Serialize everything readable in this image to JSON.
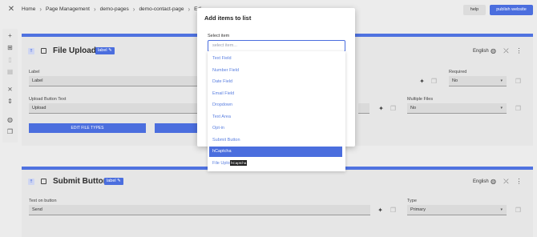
{
  "topbar": {
    "breadcrumbs": [
      "Home",
      "Page Management",
      "demo-pages",
      "demo-contact-page",
      "Edi"
    ],
    "help_label": "help",
    "publish_label": "publish website"
  },
  "card1": {
    "title": "File Upload",
    "badge": "label",
    "lang": "English",
    "label_caption": "Label",
    "label_value": "Label",
    "required_caption": "Required",
    "required_value": "No",
    "upload_caption": "Upload Button Text",
    "upload_value": "Upload",
    "multiple_caption": "Multiple Files",
    "multiple_value": "No",
    "edit_types_label": "EDIT FILE TYPES"
  },
  "card2": {
    "title": "Submit Button",
    "badge": "label",
    "lang": "English",
    "text_caption": "Text on button",
    "text_value": "Send",
    "type_caption": "Type",
    "type_value": "Primary"
  },
  "modal": {
    "title": "Add items to list",
    "select_label": "Select item",
    "placeholder": "select item..."
  },
  "dropdown": {
    "items": [
      "Text Field",
      "Number Field",
      "Date Field",
      "Email Field",
      "Dropdown",
      "Text Area",
      "Opt-in",
      "Submit Button",
      "hCaptcha",
      "File Upload"
    ],
    "selected": "hCaptcha",
    "tooltip": "hCaptcha"
  },
  "colors": {
    "accent": "#4b6ede",
    "item_text": "#5a7fe0",
    "background": "#ececec"
  }
}
